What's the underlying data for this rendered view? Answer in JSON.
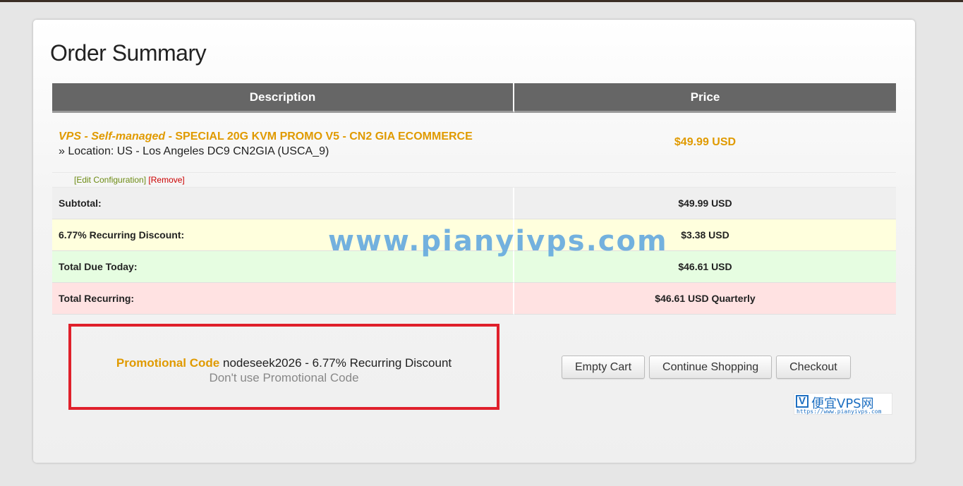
{
  "page": {
    "title": "Order Summary"
  },
  "table": {
    "headers": {
      "description": "Description",
      "price": "Price"
    },
    "product": {
      "group": "VPS - Self-managed",
      "separator": " - ",
      "name": "SPECIAL 20G KVM PROMO V5 - CN2 GIA ECOMMERCE",
      "location": "» Location: US - Los Angeles DC9 CN2GIA (USCA_9)",
      "price": "$49.99 USD",
      "edit_label": "[Edit Configuration]",
      "remove_label": "[Remove]"
    },
    "summary": [
      {
        "label": "Subtotal:",
        "value": "$49.99 USD"
      },
      {
        "label": "6.77% Recurring Discount:",
        "value": "$3.38 USD"
      },
      {
        "label": "Total Due Today:",
        "value": "$46.61 USD"
      },
      {
        "label": "Total Recurring:",
        "value": "$46.61 USD Quarterly"
      }
    ]
  },
  "watermark": "www.pianyivps.com",
  "promo": {
    "label": "Promotional Code",
    "value": "nodeseek2026 - 6.77% Recurring Discount",
    "remove": "Don't use Promotional Code"
  },
  "buttons": {
    "empty_cart": "Empty Cart",
    "continue_shopping": "Continue Shopping",
    "checkout": "Checkout"
  },
  "logo": {
    "mark": "V",
    "text": "便宜VPS网",
    "url": "https://www.pianyivps.com"
  },
  "colors": {
    "accent": "#e09a00",
    "header": "#666666",
    "highlight_border": "#e0202b"
  }
}
